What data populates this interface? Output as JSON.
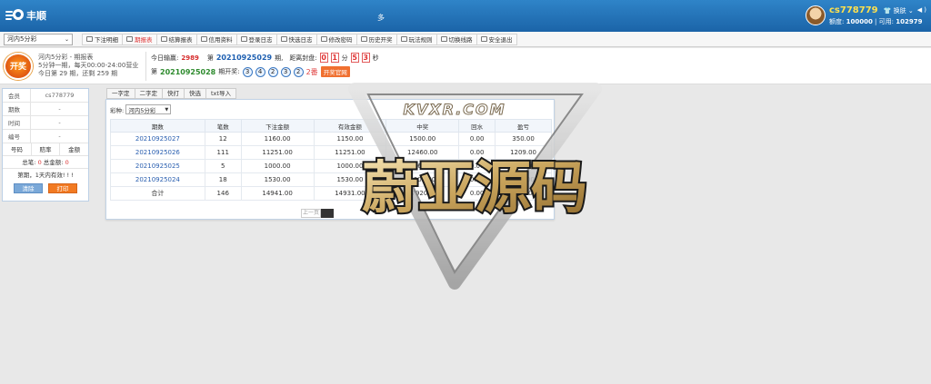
{
  "topbar": {
    "brand": "丰顺",
    "center_text": "多",
    "user": {
      "name": "cs778779",
      "credit_label": "额度:",
      "credit": "100000",
      "available_label": "可用:",
      "available": "102979",
      "switch_label": "换肤"
    }
  },
  "nav": {
    "game_select": "河内5分彩",
    "items": [
      {
        "label": "下注明细",
        "icon": "list-icon"
      },
      {
        "label": "期报表",
        "icon": "bar-chart-icon",
        "active": true
      },
      {
        "label": "结算报表",
        "icon": "bar-chart-icon"
      },
      {
        "label": "信用资料",
        "icon": "card-icon"
      },
      {
        "label": "登录日志",
        "icon": "monitor-icon"
      },
      {
        "label": "快选日志",
        "icon": "monitor-icon"
      },
      {
        "label": "修改密码",
        "icon": "lock-icon"
      },
      {
        "label": "历史开奖",
        "icon": "globe-icon"
      },
      {
        "label": "玩法规则",
        "icon": "stack-icon"
      },
      {
        "label": "切换线路",
        "icon": "wifi-icon"
      },
      {
        "label": "安全退出",
        "icon": "monitor-icon"
      }
    ]
  },
  "info": {
    "badge": "开奖",
    "game_title": "河内5分彩 - 期报表",
    "schedule": "5分钟一期，每天00:00-24:00营业",
    "today": "今日第 29 期，还剩 259 期",
    "today_win_label": "今日输赢:",
    "today_win": "2989",
    "period_label_prefix": "第",
    "period_current": "20210925029",
    "period_suffix": "期,",
    "close_label": "距离封盘:",
    "countdown": {
      "d1": "0",
      "d2": "1",
      "unit1": "分",
      "d3": "5",
      "d4": "3",
      "unit2": "秒"
    },
    "last_period_prefix": "第",
    "last_period": "20210925028",
    "last_period_suffix": "期开奖:",
    "balls": [
      "3",
      "4",
      "2",
      "3",
      "2"
    ],
    "fan_text": "2番",
    "official_button": "开奖官网"
  },
  "left": {
    "rows": [
      {
        "k": "会员",
        "v": "cs778779"
      },
      {
        "k": "期数",
        "v": "-"
      },
      {
        "k": "时间",
        "v": "-"
      },
      {
        "k": "编号",
        "v": "-"
      }
    ],
    "cols": [
      "号码",
      "赔率",
      "金额"
    ],
    "total_count_label": "总笔:",
    "total_count": "0",
    "total_amount_label": "总金额:",
    "total_amount": "0",
    "note": "第期，1天内有效! ! !",
    "clear_button": "清除",
    "print_button": "打印"
  },
  "tabs": [
    "一字定",
    "二字定",
    "快打",
    "快选",
    "txt导入"
  ],
  "filter": {
    "label": "彩种:",
    "value": "河内5分彩"
  },
  "table": {
    "headers": [
      "期数",
      "笔数",
      "下注金额",
      "有效金额",
      "中奖",
      "回水",
      "盈亏"
    ],
    "rows": [
      [
        "20210925027",
        "12",
        "1160.00",
        "1150.00",
        "1500.00",
        "0.00",
        "350.00"
      ],
      [
        "20210925026",
        "111",
        "11251.00",
        "11251.00",
        "12460.00",
        "0.00",
        "1209.00"
      ],
      [
        "20210925025",
        "5",
        "1000.00",
        "1000.00",
        "1960.00",
        "0.00",
        "960.00"
      ],
      [
        "20210925024",
        "18",
        "1530.00",
        "1530.00",
        "2000.00",
        "0.00",
        "470.00"
      ]
    ],
    "total": [
      "合计",
      "146",
      "14941.00",
      "14931.00",
      "17920.00",
      "0.00",
      "2989.00"
    ]
  },
  "pager": {
    "prev": "上一页"
  },
  "watermark": {
    "top": "KVXR.COM",
    "main": "蔚亚源码"
  }
}
